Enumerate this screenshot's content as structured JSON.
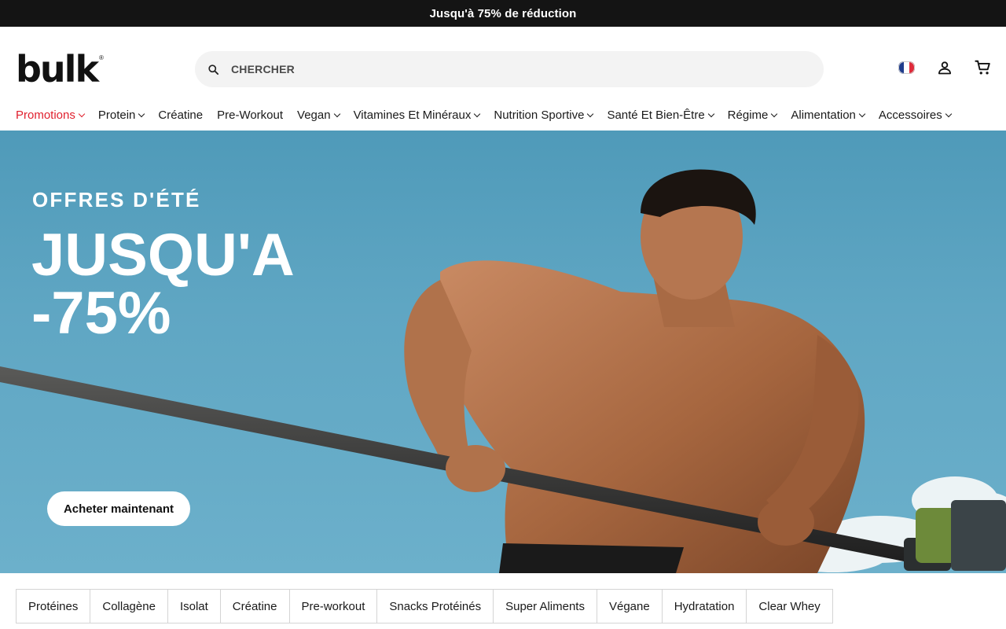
{
  "announcement": {
    "text": "Jusqu'à 75% de réduction"
  },
  "header": {
    "logo_text": "bulk",
    "logo_mark": "®",
    "search": {
      "placeholder": "CHERCHER",
      "value": ""
    },
    "icons": [
      "france-flag-icon",
      "account-icon",
      "cart-icon"
    ]
  },
  "nav": {
    "items": [
      {
        "label": "Promotions",
        "has_dropdown": true,
        "highlight": true
      },
      {
        "label": "Protein",
        "has_dropdown": true
      },
      {
        "label": "Créatine",
        "has_dropdown": false
      },
      {
        "label": "Pre-Workout",
        "has_dropdown": false
      },
      {
        "label": "Vegan",
        "has_dropdown": true
      },
      {
        "label": "Vitamines Et Minéraux",
        "has_dropdown": true
      },
      {
        "label": "Nutrition Sportive",
        "has_dropdown": true
      },
      {
        "label": "Santé Et Bien-Être",
        "has_dropdown": true
      },
      {
        "label": "Régime",
        "has_dropdown": true
      },
      {
        "label": "Alimentation",
        "has_dropdown": true
      },
      {
        "label": "Accessoires",
        "has_dropdown": true
      }
    ]
  },
  "hero": {
    "kicker": "OFFRES D'ÉTÉ",
    "title_line1": "JUSQU'A",
    "title_line2": "-75%",
    "cta": "Acheter maintenant"
  },
  "categories": [
    "Protéines",
    "Collagène",
    "Isolat",
    "Créatine",
    "Pre-workout",
    "Snacks Protéinés",
    "Super Aliments",
    "Végane",
    "Hydratation",
    "Clear Whey"
  ],
  "colors": {
    "accent": "#e0202e",
    "announcement_bg": "#141414",
    "hero_sky": "#5fa6c3"
  }
}
